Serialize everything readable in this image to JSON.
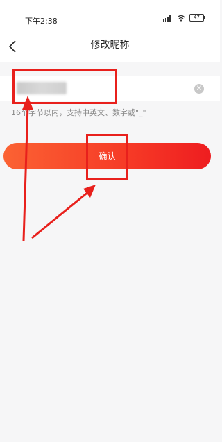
{
  "status": {
    "time": "下午2:38",
    "battery": "47"
  },
  "nav": {
    "title": "修改昵称"
  },
  "form": {
    "hint": "16个字节以内，支持中英文、数字或\"_\""
  },
  "actions": {
    "confirm_label": "确认"
  },
  "colors": {
    "accent_start": "#fb6233",
    "accent_end": "#ee1d20",
    "annotation": "#e8201c"
  }
}
